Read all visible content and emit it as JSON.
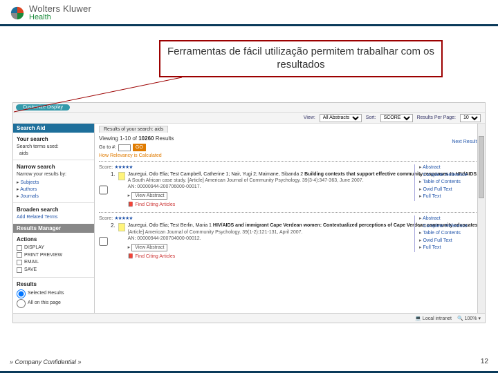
{
  "brand": {
    "main": "Wolters Kluwer",
    "sub": "Health"
  },
  "callout": "Ferramentas de fácil utilização permitem trabalhar com os resultados",
  "toolbar": {
    "view_label": "View:",
    "view_value": "All Abstracts",
    "sort_label": "Sort:",
    "sort_value": "SCORE",
    "results_label": "Results Per Page:",
    "results_value": "10"
  },
  "pill": "Customize Display",
  "sidebar": {
    "searchaid": "Search Aid",
    "your_search": "Your search",
    "search_terms_used": "Search terms used:",
    "term": "aids",
    "narrow": "Narrow search",
    "narrow_hint": "Narrow your results by:",
    "narrow_items": [
      "Subjects",
      "Authors",
      "Journals"
    ],
    "broaden": "Broaden search",
    "broaden_link": "Add Related Terms",
    "results_mgr": "Results Manager",
    "actions": "Actions",
    "action_items": [
      "DISPLAY",
      "PRINT PREVIEW",
      "EMAIL",
      "SAVE"
    ],
    "results": "Results",
    "res_selected": "Selected Results",
    "res_all": "All on this page"
  },
  "main": {
    "tab": "Results of your search: aids",
    "viewing_prefix": "Viewing 1-10 of",
    "viewing_total": "10260",
    "viewing_suffix": "Results",
    "goto": "Go to #:",
    "go": "GO",
    "relevancy": "How Relevancy is Calculated",
    "next": "Next Result ▸",
    "score_label": "Score:"
  },
  "results": [
    {
      "num": "1.",
      "authors": "Jauregui, Odo Elia; Test Campbell, Catherine 1; Nair, Yugi 2; Maimane, Sibanda 2",
      "title": "Building contexts that support effective community responses to HIV/AIDS:",
      "tail": "A South African case study. [Article] American Journal of Community Psychology. 39(3-4):347-363, June 2007.",
      "meta": "AN: 00000944-200706000-00017.",
      "view_abs": "View Abstract",
      "find_citing": "Find Citing Articles"
    },
    {
      "num": "2.",
      "authors": "Jauregui, Odo Elia; Test Berlin, Maria 1",
      "title": "HIV/AIDS and immigrant Cape Verdean women: Contextualized perceptions of Cape Verdean community advocates.",
      "tail": "[Article] American Journal of Community Psychology. 39(1-2):121-131, April 2007.",
      "meta": "AN: 00000944-200704000-00012.",
      "view_abs": "View Abstract",
      "find_citing": "Find Citing Articles"
    }
  ],
  "right_links": [
    "Abstract",
    "Complete Reference",
    "Table of Contents",
    "Ovid Full Text",
    "Full Text"
  ],
  "status": {
    "zone": "Local intranet",
    "zoom": "100%"
  },
  "footer": "» Company Confidential »",
  "page": "12"
}
